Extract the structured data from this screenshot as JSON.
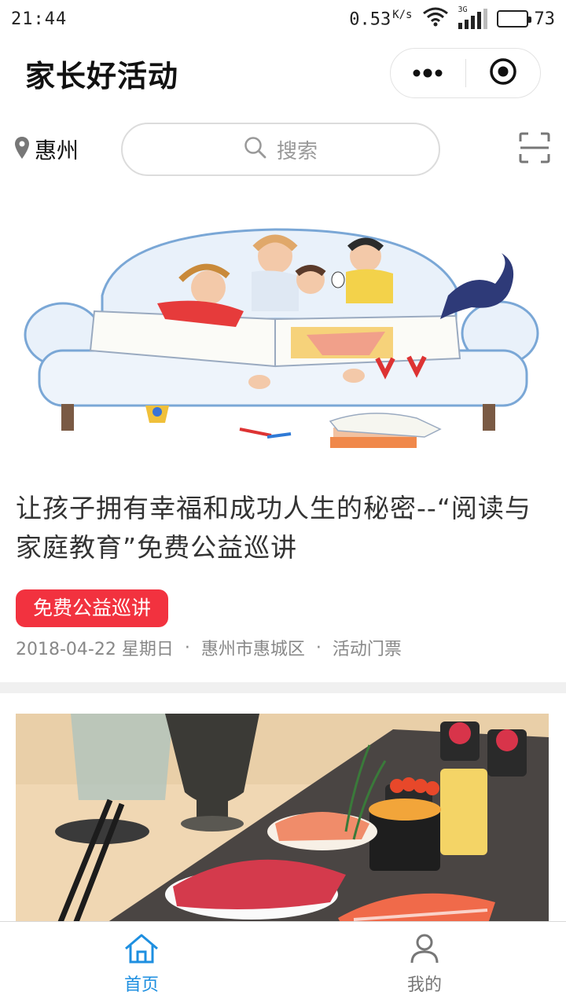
{
  "status_bar": {
    "time": "21:44",
    "net_speed": "0.53",
    "net_unit": "K/s",
    "network_type": "3G",
    "battery_level": "73",
    "battery_fraction": 0.73
  },
  "nav": {
    "title": "家长好活动",
    "more_icon": "more-dots-icon",
    "close_icon": "target-circle-icon"
  },
  "search_bar": {
    "location": "惠州",
    "placeholder": "搜索",
    "scan_icon": "scan-icon"
  },
  "feed": {
    "items": [
      {
        "title": "让孩子拥有幸福和成功人生的秘密--“阅读与家庭教育”免费公益巡讲",
        "tag": "免费公益巡讲",
        "date": "2018-04-22 星期日",
        "location": "惠州市惠城区",
        "category": "活动门票",
        "image": "family-reading-on-sofa-illustration"
      },
      {
        "image": "sushi-platter-photo"
      }
    ]
  },
  "tabs": [
    {
      "label": "首页",
      "icon": "home-icon",
      "active": true
    },
    {
      "label": "我的",
      "icon": "user-icon",
      "active": false
    }
  ],
  "colors": {
    "accent_blue": "#1e8fe0",
    "tag_red": "#f2323f",
    "meta_gray": "#888888",
    "title_text": "#333333"
  }
}
